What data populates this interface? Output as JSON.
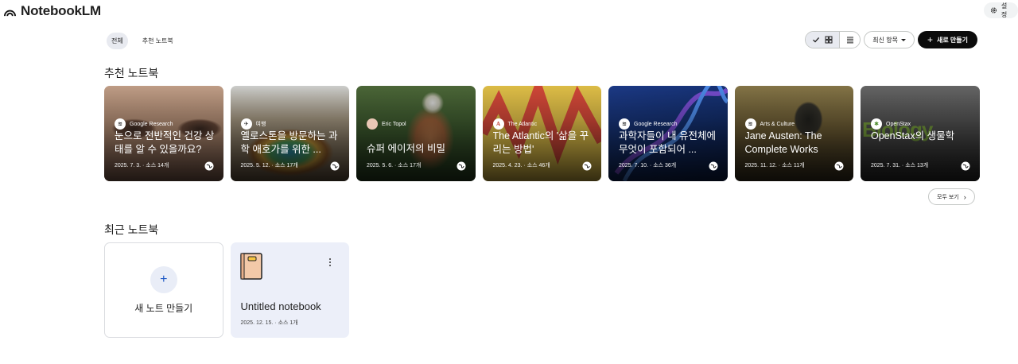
{
  "app": {
    "name": "NotebookLM",
    "settings_label": "설정"
  },
  "filters": [
    {
      "label": "전체",
      "active": true
    },
    {
      "label": "추천 노트북",
      "active": false
    }
  ],
  "toolbar": {
    "sort_label": "최신 항목",
    "create_label": "새로 만들기"
  },
  "featured": {
    "title": "추천 노트북",
    "see_all": "모두 보기",
    "cards": [
      {
        "source": "Google Research",
        "title": "눈으로 전반적인 건강 상태를 알 수 있을까요?",
        "meta": "2025. 7. 3. · 소스 14개"
      },
      {
        "source": "여행",
        "title": "옐로스톤을 방문하는 과학 애호가를 위한 ...",
        "meta": "2025. 5. 12. · 소스 17개"
      },
      {
        "source": "Eric Topol",
        "title": "슈퍼 에이저의 비밀",
        "meta": "2025. 5. 6. · 소스 17개"
      },
      {
        "source": "The Atlantic",
        "title": "The Atlantic의 '삶을 꾸리는 방법'",
        "meta": "2025. 4. 23. · 소스 46개"
      },
      {
        "source": "Google Research",
        "title": "과학자들이 내 유전체에 무엇이 포함되어 ...",
        "meta": "2025. 7. 10. · 소스 36개"
      },
      {
        "source": "Arts & Culture",
        "title": "Jane Austen: The Complete Works",
        "meta": "2025. 11. 12. · 소스 11개"
      },
      {
        "source": "OpenStax",
        "title": "OpenStax의 생물학",
        "meta": "2025. 7. 31. · 소스 13개"
      }
    ]
  },
  "recent": {
    "title": "최근 노트북",
    "new_label": "새 노트 만들기",
    "notebooks": [
      {
        "title": "Untitled notebook",
        "meta": "2025. 12. 15. · 소스 1개"
      }
    ]
  }
}
